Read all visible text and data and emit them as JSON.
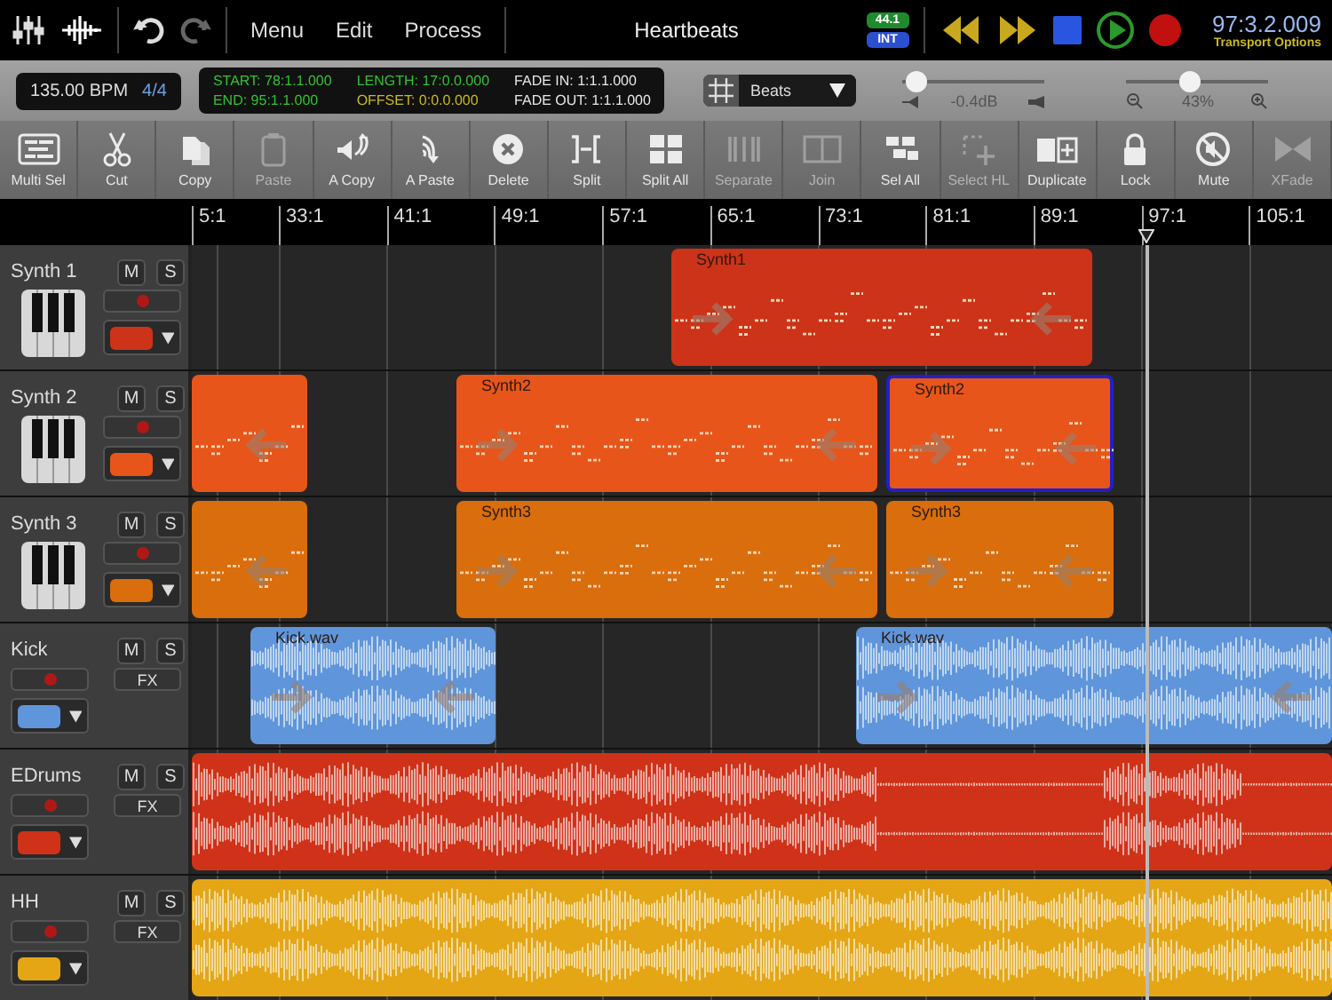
{
  "top_bar": {
    "history": [
      {
        "kind": "undo",
        "disabled": false
      },
      {
        "kind": "redo",
        "disabled": true
      }
    ],
    "menus": [
      "Menu",
      "Edit",
      "Process"
    ],
    "title": "Heartbeats",
    "sample_rate": "44.1",
    "clock_source": "INT",
    "time": "97:3.2.009",
    "transport_options": "Transport Options"
  },
  "info_bar": {
    "tempo": "135.00 BPM",
    "meter": "4/4",
    "selection_fields": [
      {
        "text": "START: 78:1.1.000",
        "color": "#33c233"
      },
      {
        "text": "END: 95:1.1.000",
        "color": "#33c233"
      },
      {
        "text": "LENGTH: 17:0.0.000",
        "color": "#33c233"
      },
      {
        "text": "OFFSET: 0:0.0.000",
        "color": "#c9b823"
      },
      {
        "text": "FADE IN: 1:1.1.000",
        "color": "#e6e6e6"
      },
      {
        "text": "FADE OUT: 1:1.1.000",
        "color": "#e6e6e6"
      }
    ],
    "grid": {
      "value": "Beats"
    },
    "volume": {
      "level": 0.1,
      "reading": "-0.4dB"
    },
    "zoom": {
      "level": 0.45,
      "reading": "43%"
    }
  },
  "toolbar": [
    {
      "kind": "multisel",
      "label": "Multi Sel",
      "disabled": false
    },
    {
      "kind": "cut",
      "label": "Cut",
      "disabled": false
    },
    {
      "kind": "copy",
      "label": "Copy",
      "disabled": false
    },
    {
      "kind": "paste",
      "label": "Paste",
      "disabled": true
    },
    {
      "kind": "acopy",
      "label": "A Copy",
      "disabled": false
    },
    {
      "kind": "apaste",
      "label": "A Paste",
      "disabled": false
    },
    {
      "kind": "delete",
      "label": "Delete",
      "disabled": false
    },
    {
      "kind": "split",
      "label": "Split",
      "disabled": false
    },
    {
      "kind": "splitall",
      "label": "Split All",
      "disabled": false
    },
    {
      "kind": "separate",
      "label": "Separate",
      "disabled": true
    },
    {
      "kind": "join",
      "label": "Join",
      "disabled": true
    },
    {
      "kind": "selall",
      "label": "Sel All",
      "disabled": false
    },
    {
      "kind": "selecthl",
      "label": "Select HL",
      "disabled": true
    },
    {
      "kind": "duplicate",
      "label": "Duplicate",
      "disabled": false
    },
    {
      "kind": "lock",
      "label": "Lock",
      "disabled": false
    },
    {
      "kind": "mute",
      "label": "Mute",
      "disabled": false
    },
    {
      "kind": "xfade",
      "label": "XFade",
      "disabled": true
    }
  ],
  "ruler": [
    "5:1",
    "33:1",
    "41:1",
    "49:1",
    "57:1",
    "65:1",
    "73:1",
    "81:1",
    "89:1",
    "97:1",
    "105:1"
  ],
  "tracks": [
    {
      "name": "Synth 1",
      "mute_label": "M",
      "solo_label": "S",
      "kind": "instrument",
      "color": "#cc3318",
      "clips": [
        {
          "label": "Synth1",
          "selected": false
        }
      ]
    },
    {
      "name": "Synth 2",
      "mute_label": "M",
      "solo_label": "S",
      "kind": "instrument",
      "color": "#e8551a",
      "clips": [
        {
          "selected": false
        },
        {
          "label": "Synth2",
          "selected": false
        },
        {
          "label": "Synth2",
          "selected": true
        }
      ]
    },
    {
      "name": "Synth 3",
      "mute_label": "M",
      "solo_label": "S",
      "kind": "instrument",
      "color": "#da6d0c",
      "clips": [
        {
          "selected": false
        },
        {
          "label": "Synth3",
          "selected": false
        },
        {
          "label": "Synth3",
          "selected": false
        }
      ]
    },
    {
      "name": "Kick",
      "mute_label": "M",
      "solo_label": "S",
      "fx_label": "FX",
      "kind": "audio",
      "color": "#5f95da",
      "clips": [
        {
          "label": "Kick.wav",
          "selected": false
        },
        {
          "label": "Kick.wav",
          "selected": false
        }
      ]
    },
    {
      "name": "EDrums",
      "mute_label": "M",
      "solo_label": "S",
      "fx_label": "FX",
      "kind": "audio",
      "color": "#cf3218",
      "clips": [
        {
          "selected": false
        }
      ]
    },
    {
      "name": "HH",
      "mute_label": "M",
      "solo_label": "S",
      "fx_label": "FX",
      "kind": "audio",
      "color": "#e5a615",
      "clips": [
        {
          "selected": false
        }
      ]
    }
  ]
}
